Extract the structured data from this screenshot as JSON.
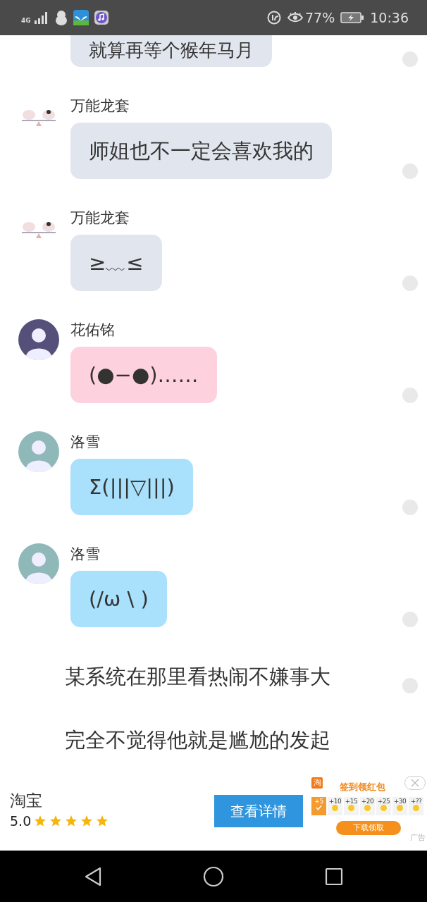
{
  "status_bar": {
    "network": "4G",
    "battery": "77%",
    "time": "10:36"
  },
  "chat": [
    {
      "kind": "message",
      "text": "就算再等个猴年马月",
      "color": "#e1e6ee",
      "dot": true
    },
    {
      "kind": "message",
      "sender": "万能龙套",
      "avatar": {
        "kind": "seesaw"
      },
      "text": "师姐也不一定会喜欢我的",
      "color": "#e1e6ee",
      "dot": true
    },
    {
      "kind": "message",
      "sender": "万能龙套",
      "avatar": {
        "kind": "seesaw"
      },
      "text": "≥﹏≤",
      "color": "#e1e6ee",
      "dot": true
    },
    {
      "kind": "message",
      "sender": "花佑铭",
      "avatar": {
        "kind": "portrait",
        "color": "#55507a"
      },
      "text": "(●−●)……",
      "color": "#fdd1dd",
      "dot": true
    },
    {
      "kind": "message",
      "sender": "洛雪",
      "avatar": {
        "kind": "portrait",
        "color": "#8fb8b8"
      },
      "text": "Σ(|||▽|||)",
      "color": "#a9e0fb",
      "dot": true
    },
    {
      "kind": "message",
      "sender": "洛雪",
      "avatar": {
        "kind": "portrait",
        "color": "#8fb8b8"
      },
      "text": "(/ω \\ )",
      "color": "#a9e0fb",
      "dot": true
    },
    {
      "kind": "narration",
      "text": "某系统在那里看热闹不嫌事大",
      "dot": true
    },
    {
      "kind": "narration",
      "text": "完全不觉得他就是尴尬的发起",
      "dot": false
    }
  ],
  "ad": {
    "app_name": "淘宝",
    "rating": "5.0",
    "stars": 5,
    "button": "查看详情",
    "banner": {
      "logo": "淘",
      "title": "签到领红包",
      "days": [
        {
          "label": "+5",
          "checked": true
        },
        {
          "label": "+10",
          "checked": false
        },
        {
          "label": "+15",
          "checked": false
        },
        {
          "label": "+20",
          "checked": false
        },
        {
          "label": "+25",
          "checked": false
        },
        {
          "label": "+30",
          "checked": false
        },
        {
          "label": "+??",
          "checked": false
        }
      ],
      "button": "下载领取"
    },
    "ad_label": "广告"
  }
}
